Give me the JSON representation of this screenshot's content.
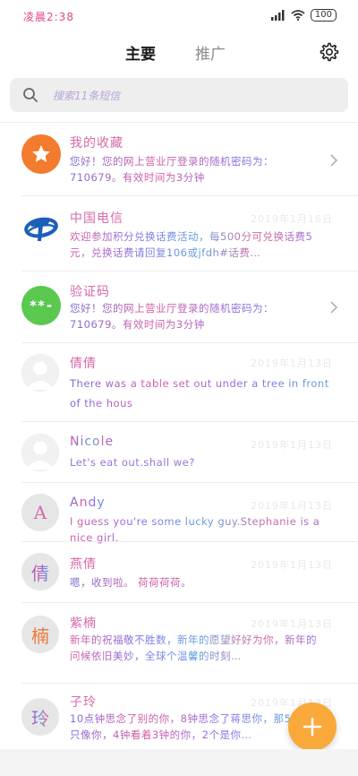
{
  "status_bar": {
    "time": "凌晨2:38",
    "battery": "100"
  },
  "header": {
    "tabs": [
      "主要",
      "推广"
    ],
    "settings_icon": "gear-icon"
  },
  "search": {
    "placeholder": "搜索11条短信"
  },
  "colors": {
    "accent_orange": "#f37b2d",
    "telecom_blue": "#1c5fb8",
    "verify_green": "#5bc84f",
    "fab_orange": "#f8a93a"
  },
  "messages": [
    {
      "name": "我的收藏",
      "time": "",
      "preview": "您好！您的网上营业厅登录的随机密码为：710679。有效时间为3分钟",
      "avatar_icon": "star-icon",
      "avatar_char": "",
      "has_chevron": true
    },
    {
      "name": "中国电信",
      "time": "2019年1月16日",
      "preview": "欢迎参加积分兑换话费活动，每500分可兑换话费5元，兑换话费请回复106或jfdh#话费…",
      "avatar_icon": "china-telecom-logo-icon",
      "avatar_char": "",
      "has_chevron": false
    },
    {
      "name": "验证码",
      "time": "",
      "preview": "您好！您的网上营业厅登录的随机密码为：710679。有效时间为3分钟",
      "avatar_icon": "verification-code-icon",
      "avatar_char": "**-",
      "has_chevron": true
    },
    {
      "name": "倩倩",
      "time": "2019年1月13日",
      "preview": "There was a table set out under a tree in front of the hous",
      "avatar_icon": "person-icon",
      "avatar_char": "",
      "has_chevron": false
    },
    {
      "name": "Nicole",
      "time": "2019年1月13日",
      "preview": "Let's eat out.shall we?",
      "avatar_icon": "person-icon",
      "avatar_char": "",
      "has_chevron": false
    },
    {
      "name": "Andy",
      "time": "2019年1月13日",
      "preview": "I guess you're some lucky guy.Stephanie is a nice girl.",
      "avatar_icon": "",
      "avatar_char": "A",
      "has_chevron": false
    },
    {
      "name": "燕倩",
      "time": "2019年1月13日",
      "preview": "嗯，收到啦。 荷荷荷荷。",
      "avatar_icon": "",
      "avatar_char": "倩",
      "has_chevron": false
    },
    {
      "name": "紫楠",
      "time": "2019年1月13日",
      "preview": "新年的祝福敬不胜数，新年的愿望好好为你，新年的问候依旧美妙，全球个温馨的时刻…",
      "avatar_icon": "",
      "avatar_char": "楠",
      "has_chevron": false
    },
    {
      "name": "子玲",
      "time": "2019年1月13日",
      "preview": "10点钟思念了别的你，8钟思念了蒋思你，那5只像你，4钟看着3钟的你，2个是你…",
      "avatar_icon": "",
      "avatar_char": "玲",
      "has_chevron": false
    }
  ],
  "fab": {
    "icon": "plus-icon"
  }
}
